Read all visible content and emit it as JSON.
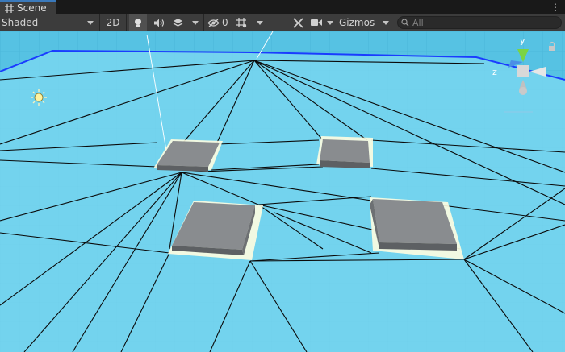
{
  "tab": {
    "title": "Scene",
    "icon": "scene-grid-icon"
  },
  "toolbar": {
    "shading_mode": "Shaded",
    "mode_2d_label": "2D",
    "hidden_count": "0",
    "gizmos_label": "Gizmos",
    "search_placeholder": "All"
  },
  "gizmo": {
    "y_label": "y",
    "z_label": "z"
  },
  "icons": {
    "lighting": "lightbulb-icon",
    "audio": "speaker-icon",
    "effects": "effects-layers-icon",
    "visibility": "eye-hidden-icon",
    "grid": "grid-snap-icon",
    "tools": "tools-icon",
    "camera": "camera-icon",
    "search": "search-icon",
    "menu": "more-vertical-icon",
    "sun": "directional-light-icon",
    "lock": "lock-icon"
  },
  "colors": {
    "navmesh": "#7ed8f2",
    "ground_grid": "#4fc3e6",
    "box_top": "#8a8d90",
    "box_side": "#5c5f62",
    "gizmo_y": "#7bd442",
    "gizmo_z": "#4b8fe6",
    "accent": "#3a79bb"
  }
}
